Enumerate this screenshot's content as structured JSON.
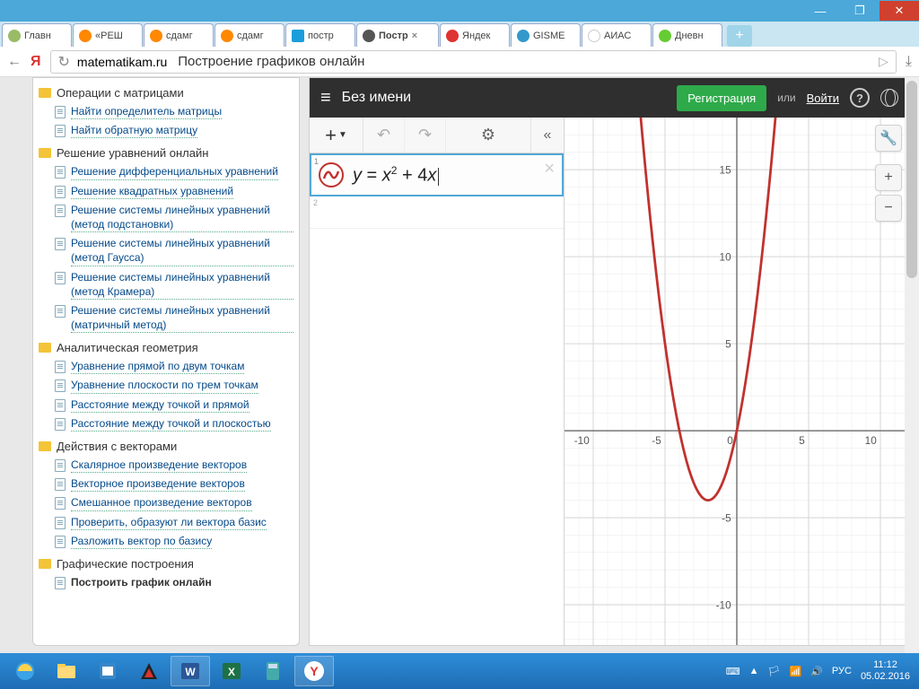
{
  "window": {
    "minimize": "—",
    "maximize": "❐",
    "close": "✕"
  },
  "tabs": {
    "items": [
      {
        "label": "Главн"
      },
      {
        "label": "«РЕШ"
      },
      {
        "label": "сдамг"
      },
      {
        "label": "сдамг"
      },
      {
        "label": "постр"
      },
      {
        "label": "Постр"
      },
      {
        "label": "Яндек"
      },
      {
        "label": "GISME"
      },
      {
        "label": "АИАС"
      },
      {
        "label": "Дневн"
      }
    ],
    "new": "+"
  },
  "address": {
    "back": "←",
    "y": "Я",
    "refresh": "↻",
    "domain": "matematikam.ru",
    "title": "Построение графиков онлайн",
    "download": "⤓"
  },
  "sidebar": {
    "groups": [
      {
        "head": "Операции с матрицами",
        "items": [
          "Найти определитель матрицы",
          "Найти обратную матрицу"
        ]
      },
      {
        "head": "Решение уравнений онлайн",
        "items": [
          "Решение дифференциальных уравнений",
          "Решение квадратных уравнений",
          "Решение системы линейных уравнений (метод подстановки)",
          "Решение системы линейных уравнений (метод Гаусса)",
          "Решение системы линейных уравнений (метод Крамера)",
          "Решение системы линейных уравнений (матричный метод)"
        ]
      },
      {
        "head": "Аналитическая геометрия",
        "items": [
          "Уравнение прямой по двум точкам",
          "Уравнение плоскости по трем точкам",
          "Расстояние между точкой и прямой",
          "Расстояние между точкой и плоскостью"
        ]
      },
      {
        "head": "Действия с векторами",
        "items": [
          "Скалярное произведение векторов",
          "Векторное произведение векторов",
          "Смешанное произведение векторов",
          "Проверить, образуют ли вектора базис",
          "Разложить вектор по базису"
        ]
      },
      {
        "head": "Графические построения",
        "items": [
          "Построить график онлайн"
        ]
      }
    ]
  },
  "app": {
    "menu": "≡",
    "title": "Без имени",
    "register": "Регистрация",
    "or": "или",
    "login": "Войти",
    "help": "?",
    "toolbar": {
      "plus": "+",
      "undo": "↶",
      "redo": "↷",
      "gear": "⚙",
      "collapse": "«"
    },
    "expr_index": "1",
    "expr_y": "y",
    "expr_eq": " = ",
    "expr_x": "x",
    "expr_sup": "2",
    "expr_plus": " + 4",
    "expr_x2": "x",
    "expr_del": "×",
    "expr2_index": "2",
    "wrench": "🔧",
    "zoom_in": "+",
    "zoom_out": "−"
  },
  "chart_data": {
    "type": "line",
    "title": "y = x² + 4x",
    "xlabel": "",
    "ylabel": "",
    "xlim": [
      -12,
      12
    ],
    "ylim": [
      -15,
      18
    ],
    "xticks": [
      -10,
      -5,
      0,
      5,
      10
    ],
    "yticks": [
      -10,
      -5,
      5,
      10,
      15
    ],
    "series": [
      {
        "name": "y = x² + 4x",
        "color": "#c0322e",
        "x": [
          -7,
          -6,
          -5,
          -4,
          -3,
          -2,
          -1,
          0,
          1,
          2,
          3
        ],
        "y": [
          21,
          12,
          5,
          0,
          -3,
          -4,
          -3,
          0,
          5,
          12,
          21
        ]
      }
    ]
  },
  "tray": {
    "kbd": "⌨",
    "up": "▲",
    "flag": "🏳",
    "net": "📶",
    "vol": "🔊",
    "lang": "РУС",
    "time": "11:12",
    "date": "05.02.2016"
  }
}
